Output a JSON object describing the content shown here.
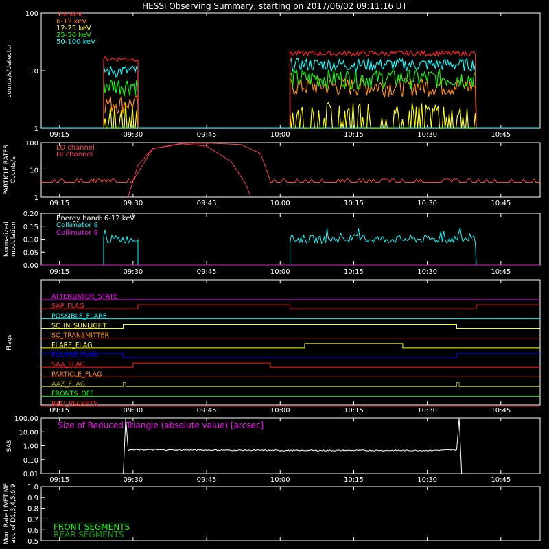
{
  "title": "HESSI Observing Summary, starting on 2017/06/02 09:11:16 UT",
  "colors": {
    "background": "#000000",
    "axes": "#ffffff",
    "c3_6": "#ff2020",
    "c6_12": "#ff8c00",
    "c12_25": "#ffff00",
    "c25_50": "#00ff00",
    "c50_100": "#00ffff",
    "hi": "#ff3060",
    "lo": "#ff4040",
    "coll8": "#00ffff",
    "coll9": "#ff00ff"
  },
  "x_tick_labels": [
    "09:15",
    "09:30",
    "09:45",
    "10:00",
    "10:15",
    "10:30",
    "10:45"
  ],
  "chart_data": [
    {
      "type": "line",
      "panel": "lightcurve",
      "ylabel": "counts/s/detector",
      "yscale": "log",
      "ylim": [
        1,
        100
      ],
      "y_tick_labels": [
        "1",
        "10",
        "100"
      ],
      "x_range": [
        "09:11:16",
        "10:53:00"
      ],
      "series": [
        {
          "name": "3-6 keV",
          "color": "#ff2020",
          "segments": [
            {
              "start": "09:24",
              "end": "09:31",
              "value": 16
            },
            {
              "start": "10:02",
              "end": "10:40",
              "value": 20
            }
          ]
        },
        {
          "name": "6-12 keV",
          "color": "#ff8c00",
          "segments": [
            {
              "start": "09:24",
              "end": "09:31",
              "value": 2.5
            },
            {
              "start": "10:02",
              "end": "10:40",
              "value": 5
            }
          ]
        },
        {
          "name": "12-25 keV",
          "color": "#ffff00",
          "segments": [
            {
              "start": "09:24",
              "end": "09:31",
              "value": 1.8
            },
            {
              "start": "10:02",
              "end": "10:40",
              "value": 2
            }
          ]
        },
        {
          "name": "25-50 keV",
          "color": "#00ff00",
          "segments": [
            {
              "start": "09:24",
              "end": "09:31",
              "value": 6
            },
            {
              "start": "10:02",
              "end": "10:40",
              "value": 8
            }
          ]
        },
        {
          "name": "50-100 keV",
          "color": "#00ffff",
          "segments": [
            {
              "start": "09:24",
              "end": "09:31",
              "value": 10
            },
            {
              "start": "10:02",
              "end": "10:40",
              "value": 13
            }
          ]
        }
      ]
    },
    {
      "type": "line",
      "panel": "particle_rates",
      "ylabel": "PARTICLE RATES Counts/s",
      "yscale": "log",
      "ylim": [
        1,
        100
      ],
      "y_tick_labels": [
        "1",
        "10",
        "100"
      ],
      "series": [
        {
          "name": "LO channel",
          "color": "#ff4040",
          "x": [
            "09:11",
            "09:22",
            "09:30",
            "09:34",
            "09:40",
            "09:46",
            "09:52",
            "09:56",
            "09:58",
            "10:53"
          ],
          "y": [
            3.5,
            3.5,
            4,
            60,
            95,
            95,
            85,
            40,
            4,
            3.5
          ]
        },
        {
          "name": "HI channel",
          "color": "#ff3060",
          "x": [
            "09:29",
            "09:31",
            "09:34",
            "09:40",
            "09:45",
            "09:50",
            "09:53",
            "09:54"
          ],
          "y": [
            1,
            15,
            60,
            90,
            75,
            20,
            3,
            1
          ]
        }
      ]
    },
    {
      "type": "line",
      "panel": "modulation",
      "ylabel": "Normalized modulation",
      "ylim": [
        0,
        0.2
      ],
      "y_tick_labels": [
        "0.00",
        "0.05",
        "0.10",
        "0.15",
        "0.20"
      ],
      "annotation": "Energy band: 6-12 keV",
      "series": [
        {
          "name": "Collimator 8",
          "color": "#00ffff",
          "segments": [
            {
              "start": "09:24",
              "end": "09:31",
              "value": 0.1
            },
            {
              "start": "10:02",
              "end": "10:40",
              "value": 0.1
            }
          ]
        },
        {
          "name": "Collimator 9",
          "color": "#ff00ff",
          "segments": [
            {
              "start": "09:11",
              "end": "10:53",
              "value": 0.0
            }
          ]
        }
      ]
    },
    {
      "type": "line",
      "panel": "flags",
      "ylabel": "Flags",
      "series": [
        {
          "name": "ATTENUATOR_STATE",
          "color": "#ff00ff",
          "steps": [
            [
              "09:11",
              0
            ],
            [
              "10:53",
              0
            ]
          ]
        },
        {
          "name": "SAP_FLAG",
          "color": "#ff2020",
          "steps": [
            [
              "09:11",
              0
            ],
            [
              "09:31",
              1
            ],
            [
              "10:02",
              0
            ],
            [
              "10:40",
              1
            ]
          ]
        },
        {
          "name": "POSSIBLE_FLARE",
          "color": "#00ffff",
          "steps": [
            [
              "09:11",
              0
            ],
            [
              "10:53",
              0
            ]
          ]
        },
        {
          "name": "SC_IN_SUNLIGHT",
          "color": "#ffff00",
          "steps": [
            [
              "09:11",
              0
            ],
            [
              "09:28",
              1
            ],
            [
              "10:36",
              0
            ]
          ]
        },
        {
          "name": "SC_TRANSMITTER",
          "color": "#ff8c00",
          "steps": [
            [
              "09:11",
              0
            ],
            [
              "10:53",
              0
            ]
          ]
        },
        {
          "name": "FLARE_FLAG",
          "color": "#ffff00",
          "steps": [
            [
              "09:11",
              0
            ],
            [
              "10:05",
              1
            ],
            [
              "10:25",
              0
            ]
          ]
        },
        {
          "name": "ECLIPSE_FLAG",
          "color": "#0000ff",
          "steps": [
            [
              "09:11",
              1
            ],
            [
              "09:28",
              0
            ],
            [
              "10:36",
              1
            ]
          ]
        },
        {
          "name": "SAA_FLAG",
          "color": "#ff2020",
          "steps": [
            [
              "09:11",
              0
            ],
            [
              "09:30",
              1
            ],
            [
              "09:58",
              0
            ]
          ]
        },
        {
          "name": "PARTICLE_FLAG",
          "color": "#ff8c00",
          "steps": [
            [
              "09:11",
              0
            ],
            [
              "10:53",
              0
            ]
          ]
        },
        {
          "name": "AAZ_FLAG",
          "color": "#a0a000",
          "steps": [
            [
              "09:11",
              0
            ],
            [
              "09:28",
              1
            ],
            [
              "09:28:30",
              0
            ],
            [
              "10:36",
              1
            ],
            [
              "10:36:30",
              0
            ]
          ]
        },
        {
          "name": "FRONTS_OFF",
          "color": "#00ff00",
          "steps": [
            [
              "09:11",
              0
            ],
            [
              "10:53",
              0
            ]
          ]
        },
        {
          "name": "BAD_PACKETS",
          "color": "#ff2020",
          "steps": [
            [
              "09:11",
              0
            ],
            [
              "10:53",
              0
            ]
          ]
        }
      ]
    },
    {
      "type": "line",
      "panel": "sas",
      "ylabel": "SAS",
      "yscale": "log",
      "ylim": [
        0.01,
        100
      ],
      "y_tick_labels": [
        "0.01",
        "0.10",
        "1.00",
        "10.00",
        "100.00"
      ],
      "annotation": "Size of Reduced Triangle (absolute value) [arcsec]",
      "series": [
        {
          "name": "Size of Reduced Triangle",
          "color": "#ffffff",
          "x": [
            "09:28",
            "09:28:30",
            "09:29",
            "09:35",
            "10:00",
            "10:30",
            "10:36",
            "10:36:30",
            "10:37"
          ],
          "y": [
            0.01,
            100,
            0.5,
            0.5,
            0.45,
            0.45,
            0.5,
            100,
            0.01
          ]
        }
      ]
    },
    {
      "type": "line",
      "panel": "livetime",
      "ylabel": "Mon. Rate LIVETIME avg of D1,3,4,5,6,9",
      "ylim": [
        0.5,
        1.0
      ],
      "y_tick_labels": [
        "0.5",
        "0.6",
        "0.7",
        "0.8",
        "0.9",
        "1.0"
      ],
      "series": [
        {
          "name": "FRONT SEGMENTS",
          "color": "#00ff00",
          "values": []
        },
        {
          "name": "REAR SEGMENTS",
          "color": "#00a000",
          "values": []
        }
      ]
    }
  ]
}
